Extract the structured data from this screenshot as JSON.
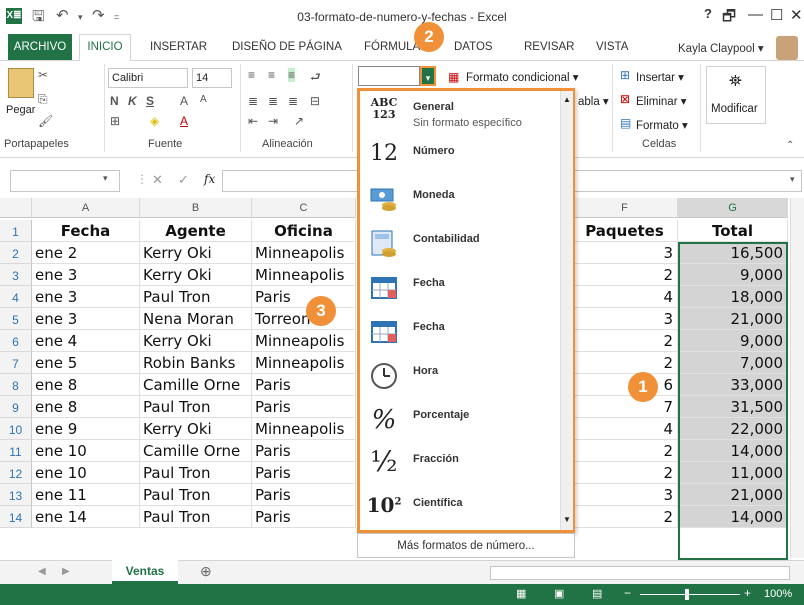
{
  "app": {
    "window_title": "03-formato-de-numero-y-fechas - Excel",
    "logo": "X≣",
    "help": "?",
    "window_buttons": [
      "🗗",
      "—",
      "☐",
      "✕"
    ]
  },
  "tabs": [
    "ARCHIVO",
    "INICIO",
    "INSERTAR",
    "DISEÑO DE PÁGINA",
    "FÓRMULAS",
    "DATOS",
    "REVISAR",
    "VISTA"
  ],
  "user": {
    "name": "Kayla Claypool ▾"
  },
  "ribbon": {
    "paste_label": "Pegar",
    "font_name": "Calibri",
    "font_size": "14",
    "font_buttons": [
      "N",
      "K",
      "S",
      "A",
      "A"
    ],
    "number_format_value": "",
    "cond_format": "Formato condicional ▾",
    "table_partial": "abla ▾",
    "insert": "Insertar ▾",
    "delete": "Eliminar ▾",
    "format": "Formato ▾",
    "modify": "Modificar",
    "groups": {
      "clipboard": "Portapapeles",
      "font": "Fuente",
      "alignment": "Alineación",
      "cells": "Celdas"
    }
  },
  "formula_bar": {
    "fx": "fx",
    "cancel": "✕",
    "confirm": "✓",
    "content": ""
  },
  "columns": [
    "A",
    "B",
    "C",
    "F",
    "G"
  ],
  "rows": [
    {
      "n": "1",
      "a": "Fecha",
      "b": "Agente",
      "c": "Oficina",
      "f": "Paquetes",
      "g": "Total"
    },
    {
      "n": "2",
      "a": "ene 2",
      "b": "Kerry Oki",
      "c": "Minneapolis",
      "f": "3",
      "g": "16,500"
    },
    {
      "n": "3",
      "a": "ene 3",
      "b": "Kerry Oki",
      "c": "Minneapolis",
      "f": "2",
      "g": "9,000"
    },
    {
      "n": "4",
      "a": "ene 3",
      "b": "Paul Tron",
      "c": "Paris",
      "f": "4",
      "g": "18,000"
    },
    {
      "n": "5",
      "a": "ene 3",
      "b": "Nena Moran",
      "c": "Torreon",
      "f": "3",
      "g": "21,000"
    },
    {
      "n": "6",
      "a": "ene 4",
      "b": "Kerry Oki",
      "c": "Minneapolis",
      "f": "2",
      "g": "9,000"
    },
    {
      "n": "7",
      "a": "ene 5",
      "b": "Robin Banks",
      "c": "Minneapolis",
      "f": "2",
      "g": "7,000"
    },
    {
      "n": "8",
      "a": "ene 8",
      "b": "Camille Orne",
      "c": "Paris",
      "f": "6",
      "g": "33,000"
    },
    {
      "n": "9",
      "a": "ene 8",
      "b": "Paul Tron",
      "c": "Paris",
      "f": "7",
      "g": "31,500"
    },
    {
      "n": "10",
      "a": "ene 9",
      "b": "Kerry Oki",
      "c": "Minneapolis",
      "f": "4",
      "g": "22,000"
    },
    {
      "n": "11",
      "a": "ene 10",
      "b": "Camille Orne",
      "c": "Paris",
      "f": "2",
      "g": "14,000"
    },
    {
      "n": "12",
      "a": "ene 10",
      "b": "Paul Tron",
      "c": "Paris",
      "f": "2",
      "g": "11,000"
    },
    {
      "n": "13",
      "a": "ene 11",
      "b": "Paul Tron",
      "c": "Paris",
      "f": "3",
      "g": "21,000"
    },
    {
      "n": "14",
      "a": "ene 14",
      "b": "Paul Tron",
      "c": "Paris",
      "f": "2",
      "g": "14,000"
    }
  ],
  "number_menu": {
    "items": [
      {
        "label": "General",
        "sub": "Sin formato específico",
        "icon": "ABC\n123"
      },
      {
        "label": "Número",
        "sub": "",
        "icon": "12"
      },
      {
        "label": "Moneda",
        "sub": "",
        "icon": "money-icon"
      },
      {
        "label": "Contabilidad",
        "sub": "",
        "icon": "accounting-icon"
      },
      {
        "label": "Fecha",
        "sub": "",
        "icon": "calendar-icon"
      },
      {
        "label": "Fecha",
        "sub": "",
        "icon": "calendar-icon"
      },
      {
        "label": "Hora",
        "sub": "",
        "icon": "clock-icon"
      },
      {
        "label": "Porcentaje",
        "sub": "",
        "icon": "%"
      },
      {
        "label": "Fracción",
        "sub": "",
        "icon": "½"
      },
      {
        "label": "Científica",
        "sub": "",
        "icon": "10²"
      }
    ],
    "more": "Más formatos de número..."
  },
  "callouts": [
    "1",
    "2",
    "3"
  ],
  "sheet_tab": "Ventas",
  "status": {
    "zoom": "100%"
  },
  "colors": {
    "excel_green": "#217346",
    "callout_orange": "#f0913a",
    "selection_gray": "#d4d4d4"
  }
}
